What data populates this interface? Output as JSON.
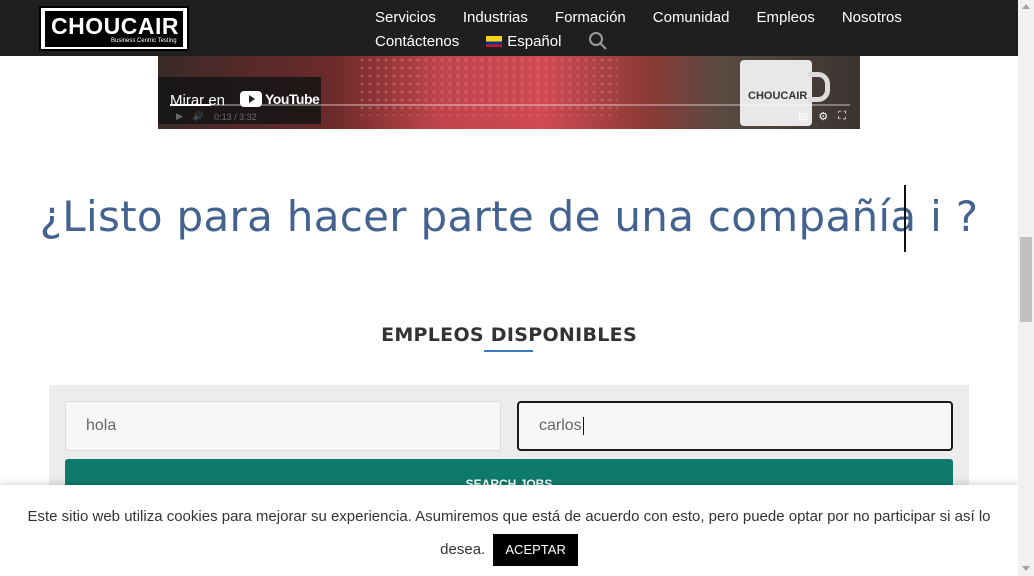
{
  "header": {
    "logo_text": "CHOUCAIR",
    "logo_tagline": "Business Centric Testing",
    "nav_row1": [
      "Servicios",
      "Industrias",
      "Formación",
      "Comunidad",
      "Empleos",
      "Nosotros"
    ],
    "nav_row2": [
      "Contáctenos"
    ],
    "language_label": "Español"
  },
  "video": {
    "watch_label": "Mirar en",
    "youtube_label": "YouTube",
    "time": "0:13 / 3:32",
    "mug_text": "CHOUCAIR",
    "progress_fraction": 0.06
  },
  "headline": "¿Listo para hacer parte de una compañía i ?",
  "section": {
    "title": "EMPLEOS DISPONIBLES",
    "keyword_value": "hola",
    "location_value": "carlos",
    "search_button": "SEARCH JOBS"
  },
  "cookie": {
    "text": "Este sitio web utiliza cookies para mejorar su experiencia. Asumiremos que está de acuerdo con esto, pero puede optar por no participar si así lo desea.",
    "accept_label": "ACEPTAR"
  },
  "colors": {
    "header_bg": "#1f1f1f",
    "headline": "#44628f",
    "button": "#0e7a6b",
    "underline": "#3b7bbf"
  }
}
